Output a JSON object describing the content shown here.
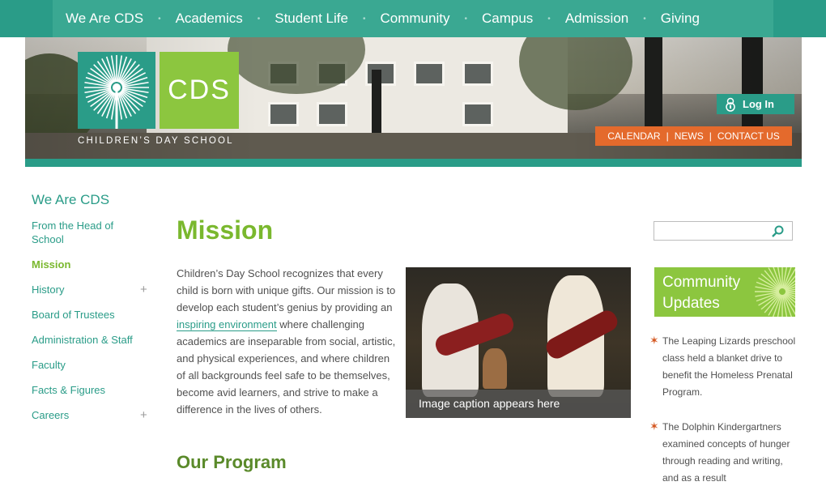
{
  "topnav": {
    "items": [
      "We Are CDS",
      "Academics",
      "Student Life",
      "Community",
      "Campus",
      "Admission",
      "Giving"
    ]
  },
  "header": {
    "logo_text": "CDS",
    "logo_tagline": "CHILDREN’S DAY SCHOOL",
    "login_label": "Log In",
    "util_links": [
      "CALENDAR",
      "NEWS",
      "CONTACT US"
    ]
  },
  "sidebar": {
    "title": "We Are CDS",
    "items": [
      {
        "label": "From the Head of School",
        "active": false,
        "expandable": false
      },
      {
        "label": "Mission",
        "active": true,
        "expandable": false
      },
      {
        "label": "History",
        "active": false,
        "expandable": true
      },
      {
        "label": "Board of Trustees",
        "active": false,
        "expandable": false
      },
      {
        "label": "Administration & Staff",
        "active": false,
        "expandable": false
      },
      {
        "label": "Faculty",
        "active": false,
        "expandable": false
      },
      {
        "label": "Facts & Figures",
        "active": false,
        "expandable": false
      },
      {
        "label": "Careers",
        "active": false,
        "expandable": true
      }
    ]
  },
  "main": {
    "title": "Mission",
    "intro_before_link": "Children’s Day School recognizes that every child is born with unique gifts. Our mission is to develop each student’s genius by providing an",
    "intro_link": "inspiring environment",
    "intro_after_link": "where challenging academics are inseparable from social, artistic, and physical experiences, and where children of all backgrounds feel safe to be themselves, become avid learners, and strive to make a difference in the lives of others.",
    "image_caption": "Image caption appears here",
    "subheading": "Our Program"
  },
  "right": {
    "search_placeholder": "",
    "community_title_line1": "Community",
    "community_title_line2": "Updates",
    "news": [
      "The Leaping Lizards preschool class held a blanket drive to benefit the Homeless Prenatal Program.",
      "The Dolphin Kindergartners examined concepts of hunger through reading and writing, and as a result"
    ]
  },
  "colors": {
    "teal": "#2a9c88",
    "green": "#8cc63f",
    "orange": "#e46a2c"
  },
  "icons": [
    "search-icon",
    "lock-icon",
    "plus-icon",
    "star-bullet-icon",
    "sunburst-icon"
  ]
}
